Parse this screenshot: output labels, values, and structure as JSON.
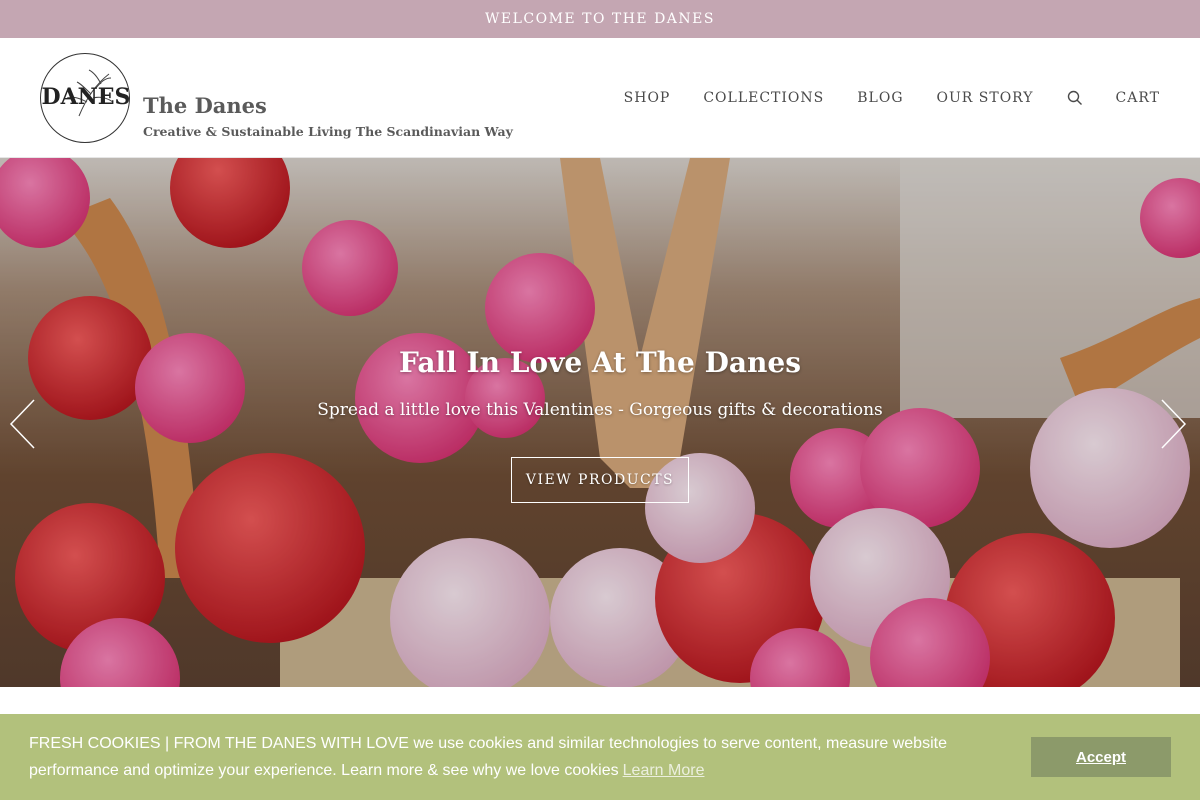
{
  "announcement": {
    "text": "WELCOME TO THE DANES"
  },
  "brand": {
    "logo_text": "DANES",
    "name": "The Danes",
    "tagline": "Creative & Sustainable Living The Scandinavian Way"
  },
  "nav": {
    "items": [
      "SHOP",
      "COLLECTIONS",
      "BLOG",
      "OUR STORY"
    ],
    "search_icon": "search-icon",
    "cart": "CART"
  },
  "hero": {
    "title": "Fall In Love At The Danes",
    "subtitle": "Spread a little love this Valentines - Gorgeous gifts & decorations",
    "button": "VIEW PRODUCTS",
    "prev_icon": "chevron-left-icon",
    "next_icon": "chevron-right-icon"
  },
  "cookie": {
    "text": "FRESH COOKIES | FROM THE DANES WITH LOVE we use cookies and similar technologies to serve content, measure website performance and optimize your experience. Learn more & see why we love cookies",
    "learn_more": "Learn More",
    "accept": "Accept"
  },
  "colors": {
    "announcement_bg": "#c4a6b2",
    "cookie_bg": "#b2c17c",
    "accept_bg": "#8c9a6a"
  }
}
